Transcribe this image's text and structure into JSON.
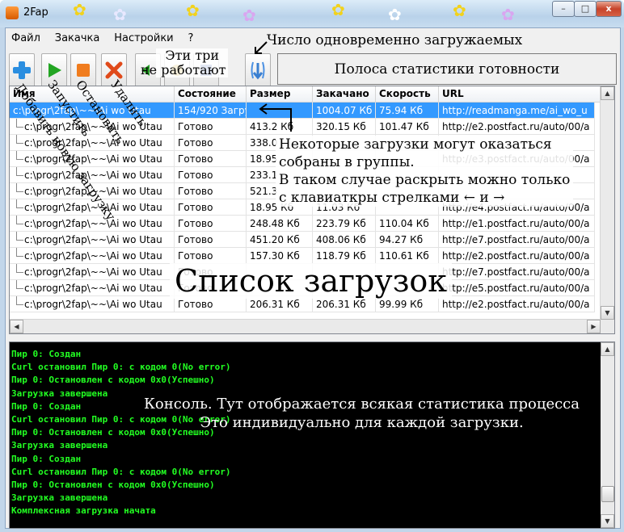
{
  "window": {
    "title": "2Fap",
    "min_label": "–",
    "max_label": "□",
    "close_label": "x"
  },
  "menu": [
    "Файл",
    "Закачка",
    "Настройки",
    "?"
  ],
  "toolbar": {
    "buttons": [
      {
        "name": "add-download-button",
        "icon": "plus-icon",
        "color": "#2a8ee0"
      },
      {
        "name": "start-button",
        "icon": "play-icon",
        "color": "#23a523"
      },
      {
        "name": "stop-button",
        "icon": "stop-icon",
        "color": "#f07c1e"
      },
      {
        "name": "delete-button",
        "icon": "x-icon",
        "color": "#e04a1a"
      },
      {
        "name": "unknown-button-1",
        "icon": "arrow-icon",
        "color": "#28a028"
      },
      {
        "name": "unknown-button-2",
        "icon": "gear-icon",
        "color": "#c8a020"
      },
      {
        "name": "unknown-button-3",
        "icon": "save-icon",
        "color": "#4060b0"
      },
      {
        "name": "concurrency-button",
        "icon": "updown-arrows-icon",
        "color": "#4a90e2"
      }
    ],
    "stats_bar_label": "Полоса статистики готовности"
  },
  "table": {
    "columns": [
      "Имя",
      "Состояние",
      "Размер",
      "Закачано",
      "Скорость",
      "URL"
    ],
    "rows": [
      {
        "name": "c:\\progr\\2fap\\~~\\Ai wo Utau",
        "state": "154/920 Загру",
        "size": "",
        "downloaded": "1004.07 Кб",
        "speed": "75.94 Кб",
        "url": "http://readmanga.me/ai_wo_u",
        "selected": true
      },
      {
        "name": "c:\\progr\\2fap\\~~\\Ai wo Utau",
        "state": "Готово",
        "size": "413.2 Кб",
        "downloaded": "320.15 Кб",
        "speed": "101.47 Кб",
        "url": "http://e2.postfact.ru/auto/00/a"
      },
      {
        "name": "c:\\progr\\2fap\\~~\\Ai wo Utau",
        "state": "Готово",
        "size": "338.0",
        "downloaded": "",
        "speed": "",
        "url": ""
      },
      {
        "name": "c:\\progr\\2fap\\~~\\Ai wo Utau",
        "state": "Готово",
        "size": "18.95",
        "downloaded": "",
        "speed": "",
        "url": "http://e3.postfact.ru/auto/00/a"
      },
      {
        "name": "c:\\progr\\2fap\\~~\\Ai wo Utau",
        "state": "Готово",
        "size": "233.1",
        "downloaded": "",
        "speed": "",
        "url": ""
      },
      {
        "name": "c:\\progr\\2fap\\~~\\Ai wo Utau",
        "state": "Готово",
        "size": "521.3",
        "downloaded": "",
        "speed": "",
        "url": ""
      },
      {
        "name": "c:\\progr\\2fap\\~~\\Ai wo Utau",
        "state": "Готово",
        "size": "18.95 Кб",
        "downloaded": "11.03 Кб",
        "speed": "",
        "url": "http://e4.postfact.ru/auto/00/a"
      },
      {
        "name": "c:\\progr\\2fap\\~~\\Ai wo Utau",
        "state": "Готово",
        "size": "248.48 Кб",
        "downloaded": "223.79 Кб",
        "speed": "110.04 Кб",
        "url": "http://e1.postfact.ru/auto/00/a"
      },
      {
        "name": "c:\\progr\\2fap\\~~\\Ai wo Utau",
        "state": "Готово",
        "size": "451.20 Кб",
        "downloaded": "408.06 Кб",
        "speed": "94.27 Кб",
        "url": "http://e7.postfact.ru/auto/00/a"
      },
      {
        "name": "c:\\progr\\2fap\\~~\\Ai wo Utau",
        "state": "Готово",
        "size": "157.30 Кб",
        "downloaded": "118.79 Кб",
        "speed": "110.61 Кб",
        "url": "http://e2.postfact.ru/auto/00/a"
      },
      {
        "name": "c:\\progr\\2fap\\~~\\Ai wo Utau",
        "state": "Готово",
        "size": "",
        "downloaded": "",
        "speed": "",
        "url": "http://e7.postfact.ru/auto/00/a"
      },
      {
        "name": "c:\\progr\\2fap\\~~\\Ai wo Utau",
        "state": "Готово",
        "size": "",
        "downloaded": "",
        "speed": "",
        "url": "http://e5.postfact.ru/auto/00/a"
      },
      {
        "name": "c:\\progr\\2fap\\~~\\Ai wo Utau",
        "state": "Готово",
        "size": "206.31 Кб",
        "downloaded": "206.31 Кб",
        "speed": "99.99 Кб",
        "url": "http://e2.postfact.ru/auto/00/a"
      }
    ]
  },
  "console": {
    "lines": [
      "Пир 0: Создан",
      "Curl остановил Пир 0: с кодом 0(No error)",
      "Пир 0: Остановлен с кодом 0x0(Успешно)",
      "Загрузка завершена",
      "Пир 0: Создан",
      "Curl остановил Пир 0: с кодом 0(No error)",
      "Пир 0: Остановлен с кодом 0x0(Успешно)",
      "Загрузка завершена",
      "Пир 0: Создан",
      "Curl остановил Пир 0: с кодом 0(No error)",
      "Пир 0: Остановлен с кодом 0x0(Успешно)",
      "Загрузка завершена",
      "Комплексная загрузка начата"
    ]
  },
  "annotations": {
    "concurrent": "Число одновременно загружаемых",
    "not_working_1": "Эти три",
    "not_working_2": "не работают",
    "groups_1": "Некоторые загрузки могут оказаться",
    "groups_2": "собраны в группы.",
    "groups_3": "В таком случае раскрыть можно только",
    "groups_4": "с клавиаткры стрелками ← и →",
    "list_title": "Список загрузок",
    "console_1": "Консоль. Тут отображается всякая статистика процесса",
    "console_2": "Это индивидуально для каждой загрузки.",
    "rot_add": "Добавить новую загрузку",
    "rot_start": "Запустить",
    "rot_stop": "Остановить",
    "rot_delete": "Удалить"
  },
  "colors": {
    "selection": "#3399ff",
    "console_bg": "#000000",
    "console_text": "#22ff22"
  }
}
